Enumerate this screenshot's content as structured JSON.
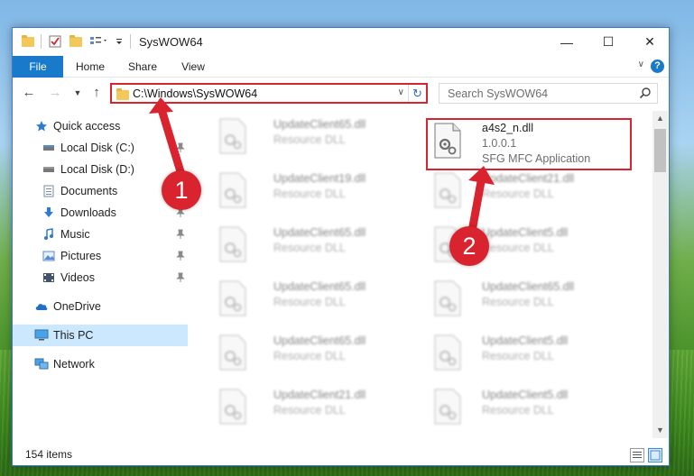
{
  "window": {
    "title": "SysWOW64",
    "controls": {
      "minimize": "—",
      "maximize": "☐",
      "close": "✕"
    }
  },
  "ribbon": {
    "tabs": [
      "File",
      "Home",
      "Share",
      "View"
    ],
    "help": "?"
  },
  "address": {
    "path": "C:\\Windows\\SysWOW64"
  },
  "search": {
    "placeholder": "Search SysWOW64"
  },
  "nav": {
    "items": [
      {
        "label": "Quick access",
        "icon": "star-icon",
        "pinned": false
      },
      {
        "label": "Local Disk (C:)",
        "icon": "drive-icon",
        "pinned": true
      },
      {
        "label": "Local Disk (D:)",
        "icon": "drive-icon",
        "pinned": false
      },
      {
        "label": "Documents",
        "icon": "documents-icon",
        "pinned": true
      },
      {
        "label": "Downloads",
        "icon": "download-icon",
        "pinned": true
      },
      {
        "label": "Music",
        "icon": "music-icon",
        "pinned": true
      },
      {
        "label": "Pictures",
        "icon": "pictures-icon",
        "pinned": true
      },
      {
        "label": "Videos",
        "icon": "videos-icon",
        "pinned": true
      },
      {
        "label": "OneDrive",
        "icon": "cloud-icon",
        "pinned": false
      },
      {
        "label": "This PC",
        "icon": "computer-icon",
        "pinned": false,
        "selected": true
      },
      {
        "label": "Network",
        "icon": "network-icon",
        "pinned": false
      }
    ]
  },
  "files": {
    "left_column": [
      {
        "name": "UpdateClient65.dll",
        "type": "Resource DLL"
      },
      {
        "name": "UpdateClient19.dll",
        "type": "Resource DLL"
      },
      {
        "name": "UpdateClient65.dll",
        "type": "Resource DLL"
      },
      {
        "name": "UpdateClient65.dll",
        "type": "Resource DLL"
      },
      {
        "name": "UpdateClient65.dll",
        "type": "Resource DLL"
      },
      {
        "name": "UpdateClient21.dll",
        "type": "Resource DLL"
      }
    ],
    "right_column": [
      {
        "name": "a4s2_n.dll",
        "version": "1.0.0.1",
        "type": "SFG MFC Application",
        "highlighted": true
      },
      {
        "name": "UpdateClient21.dll",
        "type": "Resource DLL"
      },
      {
        "name": "UpdateClient5.dll",
        "type": "Resource DLL"
      },
      {
        "name": "UpdateClient65.dll",
        "type": "Resource DLL"
      },
      {
        "name": "UpdateClient5.dll",
        "type": "Resource DLL"
      },
      {
        "name": "UpdateClient5.dll",
        "type": "Resource DLL"
      }
    ]
  },
  "status": {
    "item_count": "154 items"
  },
  "annotations": {
    "marker_1": "1",
    "marker_2": "2",
    "color": "#d9232e"
  }
}
